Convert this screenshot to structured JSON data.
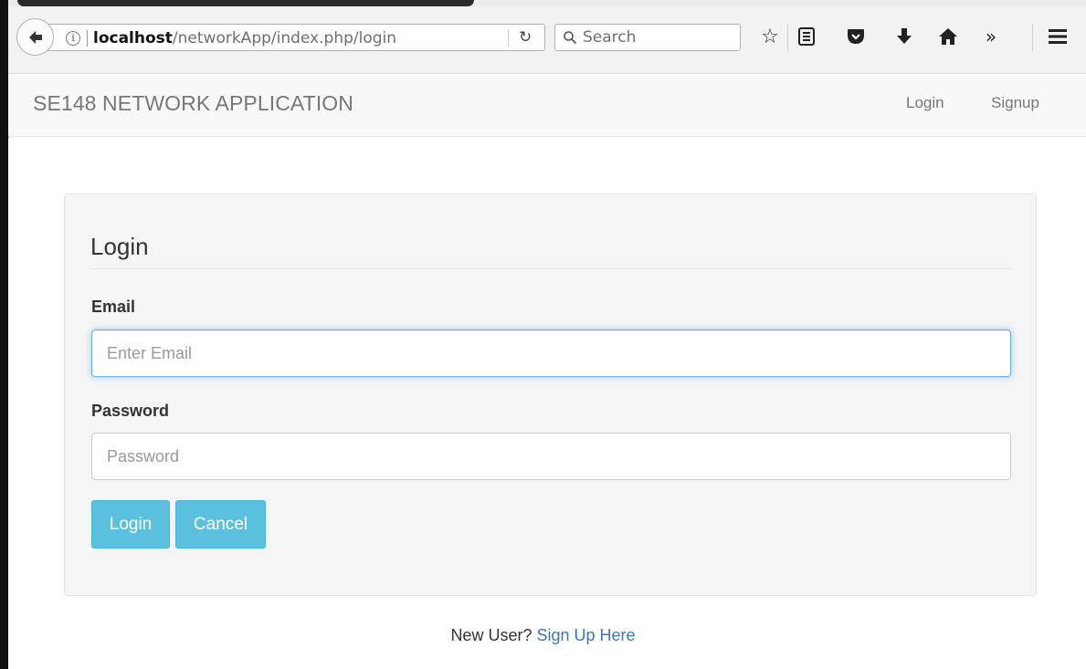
{
  "browser": {
    "url_host": "localhost",
    "url_path": "/networkApp/index.php/login",
    "search_placeholder": "Search",
    "icons": [
      "back-icon",
      "info-icon",
      "reload-icon",
      "search-icon",
      "bookmark-star-icon",
      "reading-list-icon",
      "pocket-icon",
      "download-icon",
      "home-icon",
      "overflow-icon",
      "menu-icon"
    ]
  },
  "navbar": {
    "brand": "SE148 NETWORK APPLICATION",
    "links": [
      {
        "label": "Login"
      },
      {
        "label": "Signup"
      }
    ]
  },
  "form": {
    "title": "Login",
    "email_label": "Email",
    "email_placeholder": "Enter Email",
    "password_label": "Password",
    "password_placeholder": "Password",
    "login_button": "Login",
    "cancel_button": "Cancel"
  },
  "footer": {
    "prompt": "New User?",
    "link": "Sign Up Here"
  },
  "colors": {
    "info_button": "#5bc0de",
    "link": "#337ab7",
    "focus_border": "#66afe9"
  }
}
